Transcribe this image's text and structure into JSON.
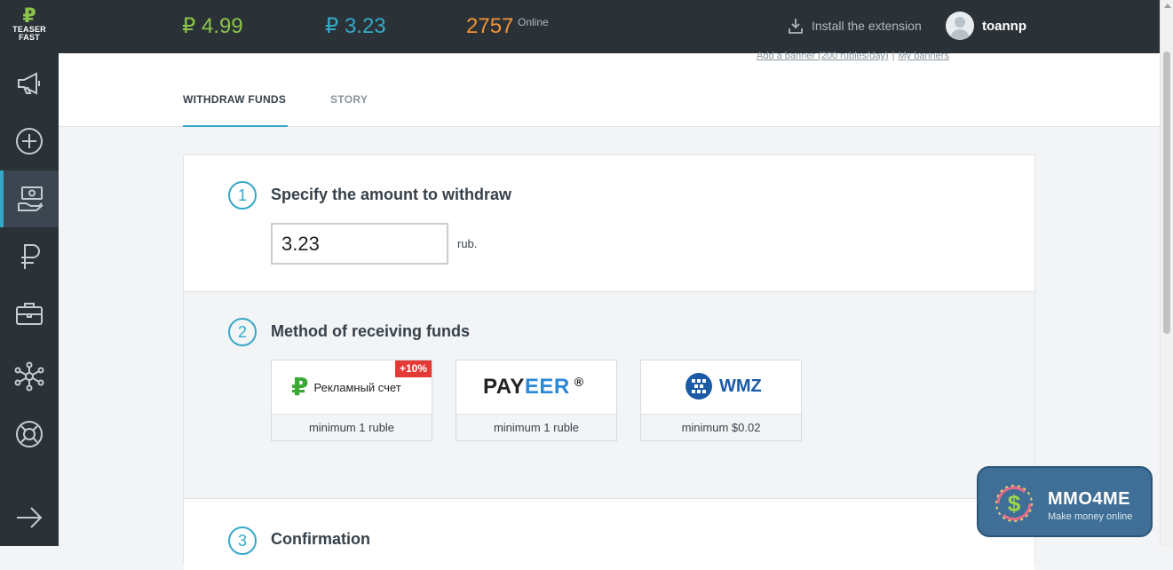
{
  "logo": {
    "glyph": "₽",
    "line1": "TEASER",
    "line2": "FAST"
  },
  "sidebar": {
    "items": [
      {
        "icon": "megaphone-icon"
      },
      {
        "icon": "plus-circle-icon"
      },
      {
        "icon": "money-hand-icon",
        "active": true
      },
      {
        "icon": "ruble-icon"
      },
      {
        "icon": "briefcase-icon"
      },
      {
        "icon": "network-icon"
      },
      {
        "icon": "lifebuoy-icon"
      },
      {
        "icon": "arrow-right-icon"
      }
    ]
  },
  "topbar": {
    "balance_green": "₽ 4.99",
    "balance_blue": "₽ 3.23",
    "online_count": "2757",
    "online_label": "Online",
    "install_label": "Install the extension",
    "username": "toannp"
  },
  "links": {
    "add_banner": "Add a banner (200 rubles/day)",
    "separator": "|",
    "my_banners": "My banners"
  },
  "tabs": {
    "withdraw": "WITHDRAW FUNDS",
    "story": "STORY"
  },
  "step1": {
    "number": "1",
    "title": "Specify the amount to withdraw",
    "amount": "3.23",
    "unit": "rub."
  },
  "step2": {
    "number": "2",
    "title": "Method of receiving funds",
    "methods": [
      {
        "name": "Рекламный счет",
        "symbol": "₽",
        "badge": "+10%",
        "min": "minimum 1 ruble"
      },
      {
        "name_part1": "PAY",
        "name_part2": "EER",
        "reg": "®",
        "min": "minimum 1 ruble"
      },
      {
        "name": "WMZ",
        "min": "minimum $0.02"
      }
    ]
  },
  "step3": {
    "number": "3",
    "title": "Confirmation"
  },
  "watermark": {
    "title": "MMO4ME",
    "subtitle": "Make money online",
    "symbol": "$"
  },
  "colors": {
    "dark": "#2a3238",
    "accent_blue": "#35a8c8",
    "green": "#8bc34a",
    "orange": "#f39233",
    "badge_red": "#e53935"
  }
}
